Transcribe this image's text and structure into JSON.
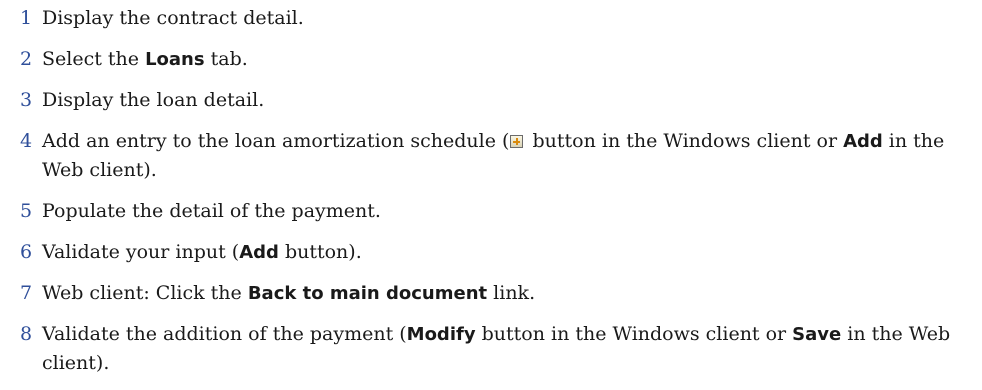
{
  "steps": [
    {
      "num": "1",
      "t1": "Display the contract detail."
    },
    {
      "num": "2",
      "t1": "Select the ",
      "b1": "Loans",
      "t2": " tab."
    },
    {
      "num": "3",
      "t1": "Display the loan detail."
    },
    {
      "num": "4",
      "t1": "Add an entry to the loan amortization schedule (",
      "t2": " button in the Windows client or ",
      "b1": "Add",
      "t3": " in the Web client)."
    },
    {
      "num": "5",
      "t1": "Populate the detail of the payment."
    },
    {
      "num": "6",
      "t1": "Validate your input (",
      "b1": "Add",
      "t2": " button)."
    },
    {
      "num": "7",
      "t1": "Web client: Click the ",
      "b1": "Back to main document",
      "t2": " link."
    },
    {
      "num": "8",
      "t1": "Validate the addition of the payment (",
      "b1": "Modify",
      "t2": " button in the Windows client or ",
      "b2": "Save",
      "t3": " in the Web client)."
    }
  ],
  "icons": {
    "add_entry": "plus-icon"
  }
}
